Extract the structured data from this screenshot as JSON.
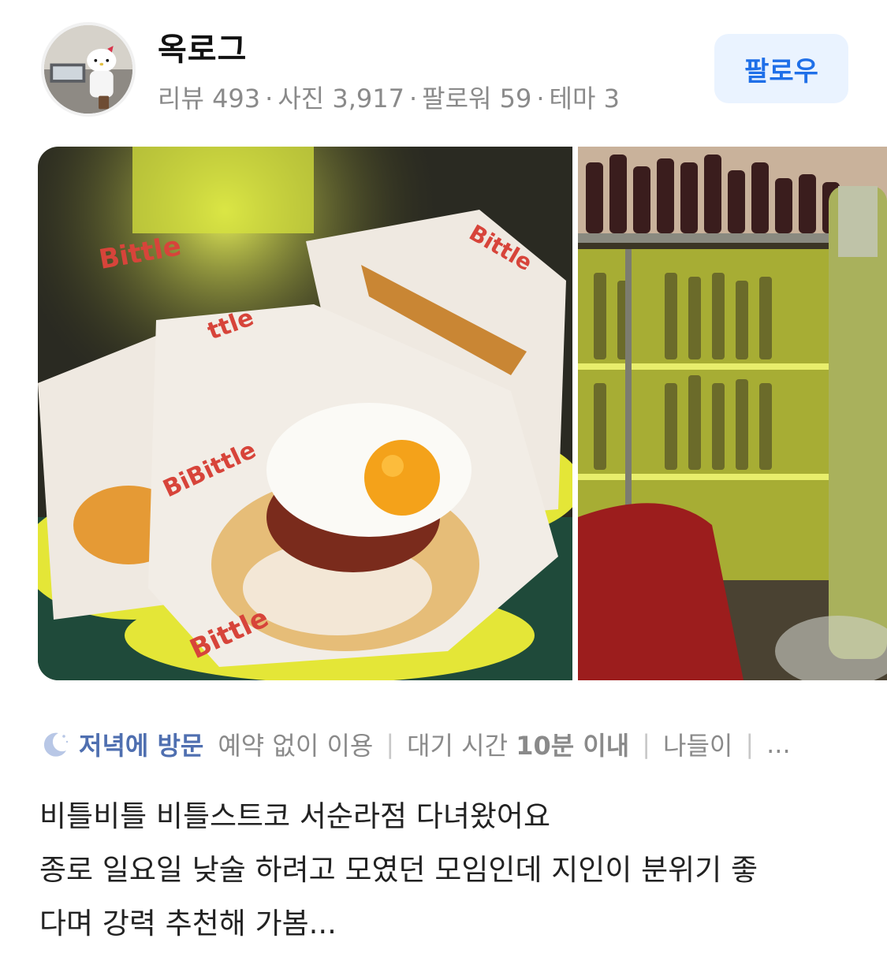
{
  "profile": {
    "name": "옥로그",
    "stats": [
      {
        "label": "리뷰",
        "value": "493"
      },
      {
        "label": "사진",
        "value": "3,917"
      },
      {
        "label": "팔로워",
        "value": "59"
      },
      {
        "label": "테마",
        "value": "3"
      }
    ],
    "follow_label": "팔로우"
  },
  "photos": [
    {
      "desc": "food-basket-photo"
    },
    {
      "desc": "wine-bar-photo"
    }
  ],
  "tags": {
    "icon": "moon-icon",
    "visit_time": "저녁에 방문",
    "reservation": "예약 없이 이용",
    "wait_label": "대기 시간",
    "wait_value": "10분 이내",
    "purpose": "나들이",
    "more": "..."
  },
  "review": {
    "lines": [
      "비틀비틀 비틀스트코 서순라점 다녀왔어요",
      "종로 일요일 낮술 하려고 모였던 모임인데 지인이 분위기 좋",
      "다며 강력 추천해 가봄..."
    ]
  },
  "colors": {
    "accent": "#1f6fe8",
    "follow_bg": "#eaf3ff",
    "visit_tag": "#4f6fb0",
    "muted": "#8a8a8a"
  }
}
